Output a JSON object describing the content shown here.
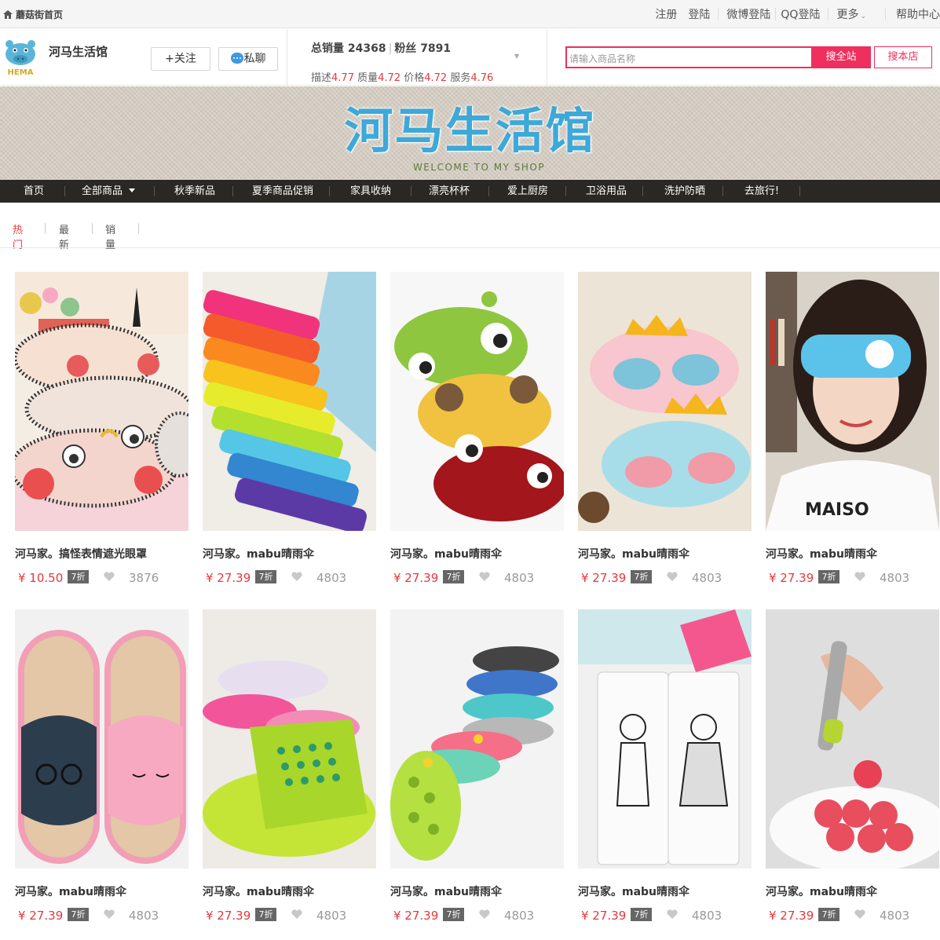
{
  "topbar": {
    "home_label": "蘑菇街首页",
    "register": "注册",
    "login": "登陆",
    "weibo_login": "微博登陆",
    "qq_login": "QQ登陆",
    "more": "更多",
    "help": "帮助中心"
  },
  "shop": {
    "logo_text": "HEMA",
    "name": "河马生活馆",
    "follow_label": "+关注",
    "chat_label": "私聊",
    "total_sales_label": "总销量",
    "total_sales": "24368",
    "fans_label": "粉丝",
    "fans": "7891",
    "ratings": [
      {
        "label": "描述",
        "value": "4.77"
      },
      {
        "label": "质量",
        "value": "4.72"
      },
      {
        "label": "价格",
        "value": "4.72"
      },
      {
        "label": "服务",
        "value": "4.76"
      }
    ]
  },
  "search": {
    "placeholder": "请输入商品名称",
    "search_all_label": "搜全站",
    "search_shop_label": "搜本店"
  },
  "banner": {
    "title": "河马生活馆",
    "subtitle": "WELCOME TO MY SHOP"
  },
  "nav": {
    "items": [
      "首页",
      "全部商品",
      "秋季新品",
      "夏季商品促销",
      "家具收纳",
      "漂亮杯杯",
      "爱上厨房",
      "卫浴用品",
      "洗护防晒",
      "去旅行!"
    ]
  },
  "sort_tabs": [
    "热门",
    "最新",
    "销量"
  ],
  "colors": {
    "accent": "#ef2f5d",
    "price": "#e4393c",
    "nav_bg": "#2b2724"
  },
  "products": [
    {
      "name": "河马家。搞怪表情遮光眼罩",
      "price": "¥ 10.50",
      "discount": "7折",
      "likes": "3876",
      "image": "cartoon-eye-masks"
    },
    {
      "name": "河马家。mabu晴雨伞",
      "price": "¥ 27.39",
      "discount": "7折",
      "likes": "4803",
      "image": "colorful-umbrellas"
    },
    {
      "name": "河马家。mabu晴雨伞",
      "price": "¥ 27.39",
      "discount": "7折",
      "likes": "4803",
      "image": "plush-eye-masks"
    },
    {
      "name": "河马家。mabu晴雨伞",
      "price": "¥ 27.39",
      "discount": "7折",
      "likes": "4803",
      "image": "crown-eye-masks"
    },
    {
      "name": "河马家。mabu晴雨伞",
      "price": "¥ 27.39",
      "discount": "7折",
      "likes": "4803",
      "image": "girl-wearing-eye-mask"
    },
    {
      "name": "河马家。mabu晴雨伞",
      "price": "¥ 27.39",
      "discount": "7折",
      "likes": "4803",
      "image": "cat-slippers"
    },
    {
      "name": "河马家。mabu晴雨伞",
      "price": "¥ 27.39",
      "discount": "7折",
      "likes": "4803",
      "image": "bath-slippers"
    },
    {
      "name": "河马家。mabu晴雨伞",
      "price": "¥ 27.39",
      "discount": "7折",
      "likes": "4803",
      "image": "hollow-slippers"
    },
    {
      "name": "河马家。mabu晴雨伞",
      "price": "¥ 27.39",
      "discount": "7折",
      "likes": "4803",
      "image": "illustrated-pouches"
    },
    {
      "name": "河马家。mabu晴雨伞",
      "price": "¥ 27.39",
      "discount": "7折",
      "likes": "4803",
      "image": "melon-baller"
    }
  ]
}
